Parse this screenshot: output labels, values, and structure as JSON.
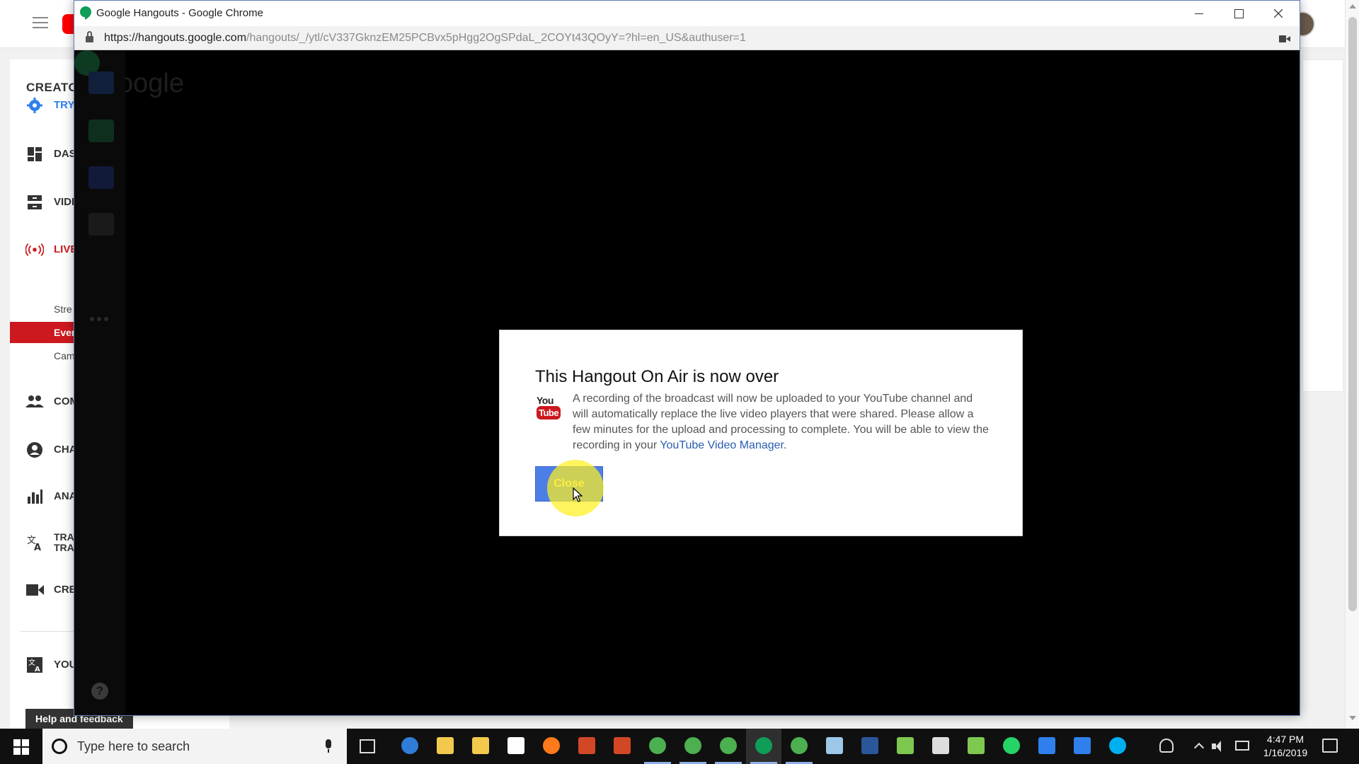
{
  "youtube_page": {
    "sidebar": {
      "creator_label": "CREATO",
      "nav_items": [
        {
          "label": "TRY",
          "icon": "gear-icon",
          "color": "#2f80ed"
        },
        {
          "label": "DAS",
          "icon": "dashboard-icon"
        },
        {
          "label": "VIDE",
          "icon": "video-manager-icon"
        },
        {
          "label": "LIVE",
          "icon": "live-broadcast-icon",
          "color": "#cc181e"
        },
        {
          "label": "COM",
          "icon": "community-icon"
        },
        {
          "label": "CHA",
          "icon": "channel-icon"
        },
        {
          "label": "ANA",
          "icon": "analytics-icon"
        },
        {
          "label_line1": "TRA",
          "label_line2": "TRA",
          "icon": "translate-icon"
        },
        {
          "label": "CRE",
          "icon": "create-video-icon"
        },
        {
          "label": "YOU",
          "icon": "translate-icon"
        }
      ],
      "live_sub_items": [
        {
          "label": "Stre"
        },
        {
          "label": "Even",
          "active": true
        },
        {
          "label": "Cam"
        }
      ],
      "help_feedback": "Help and feedback"
    }
  },
  "window": {
    "title": "Google Hangouts - Google Chrome",
    "url_host": "https://hangouts.google.com",
    "url_path": "/hangouts/_/ytl/cV337GknzEM25PCBvx5pHgg2OgSPdaL_2COYt43QOyY=?hl=en_US&authuser=1",
    "hangout": {
      "logo_text": "oogle",
      "help_glyph": "?"
    }
  },
  "dialog": {
    "title": "This Hangout On Air is now over",
    "body_text": "A recording of the broadcast will now be uploaded to your YouTube channel and will automatically replace the live video players that were shared. Please allow a few minutes for the upload and processing to complete. You will be able to view the recording in your ",
    "link_text": "YouTube Video Manager",
    "body_end": ".",
    "youtube_badge_top": "You",
    "youtube_badge_bottom": "Tube",
    "close_label": "Close",
    "accent_color": "#4d7ee8"
  },
  "taskbar": {
    "search_placeholder": "Type here to search",
    "time": "4:47 PM",
    "date": "1/16/2019",
    "apps": [
      {
        "name": "edge",
        "color": "#2f7dd6"
      },
      {
        "name": "file-explorer",
        "color": "#f2c94c"
      },
      {
        "name": "file-explorer-2",
        "color": "#f2c94c"
      },
      {
        "name": "camtasia",
        "color": "#ffffff"
      },
      {
        "name": "firefox",
        "color": "#ff7a1a"
      },
      {
        "name": "powerpoint",
        "color": "#d24726"
      },
      {
        "name": "powerpoint-2",
        "color": "#d24726"
      },
      {
        "name": "chrome",
        "color": "#4caf50"
      },
      {
        "name": "chrome-2",
        "color": "#4caf50"
      },
      {
        "name": "chrome-3",
        "color": "#4caf50"
      },
      {
        "name": "hangouts",
        "color": "#0f9d58"
      },
      {
        "name": "chrome-4",
        "color": "#4caf50"
      },
      {
        "name": "notepad",
        "color": "#9cc7e8"
      },
      {
        "name": "word",
        "color": "#2b579a"
      },
      {
        "name": "game",
        "color": "#7ec850"
      },
      {
        "name": "calculator",
        "color": "#dddddd"
      },
      {
        "name": "camtasia-2",
        "color": "#7ec850"
      },
      {
        "name": "whatsapp",
        "color": "#25d366"
      },
      {
        "name": "todo",
        "color": "#2f80ed"
      },
      {
        "name": "remote-desktop",
        "color": "#2f80ed"
      },
      {
        "name": "skype",
        "color": "#00aff0"
      }
    ]
  }
}
